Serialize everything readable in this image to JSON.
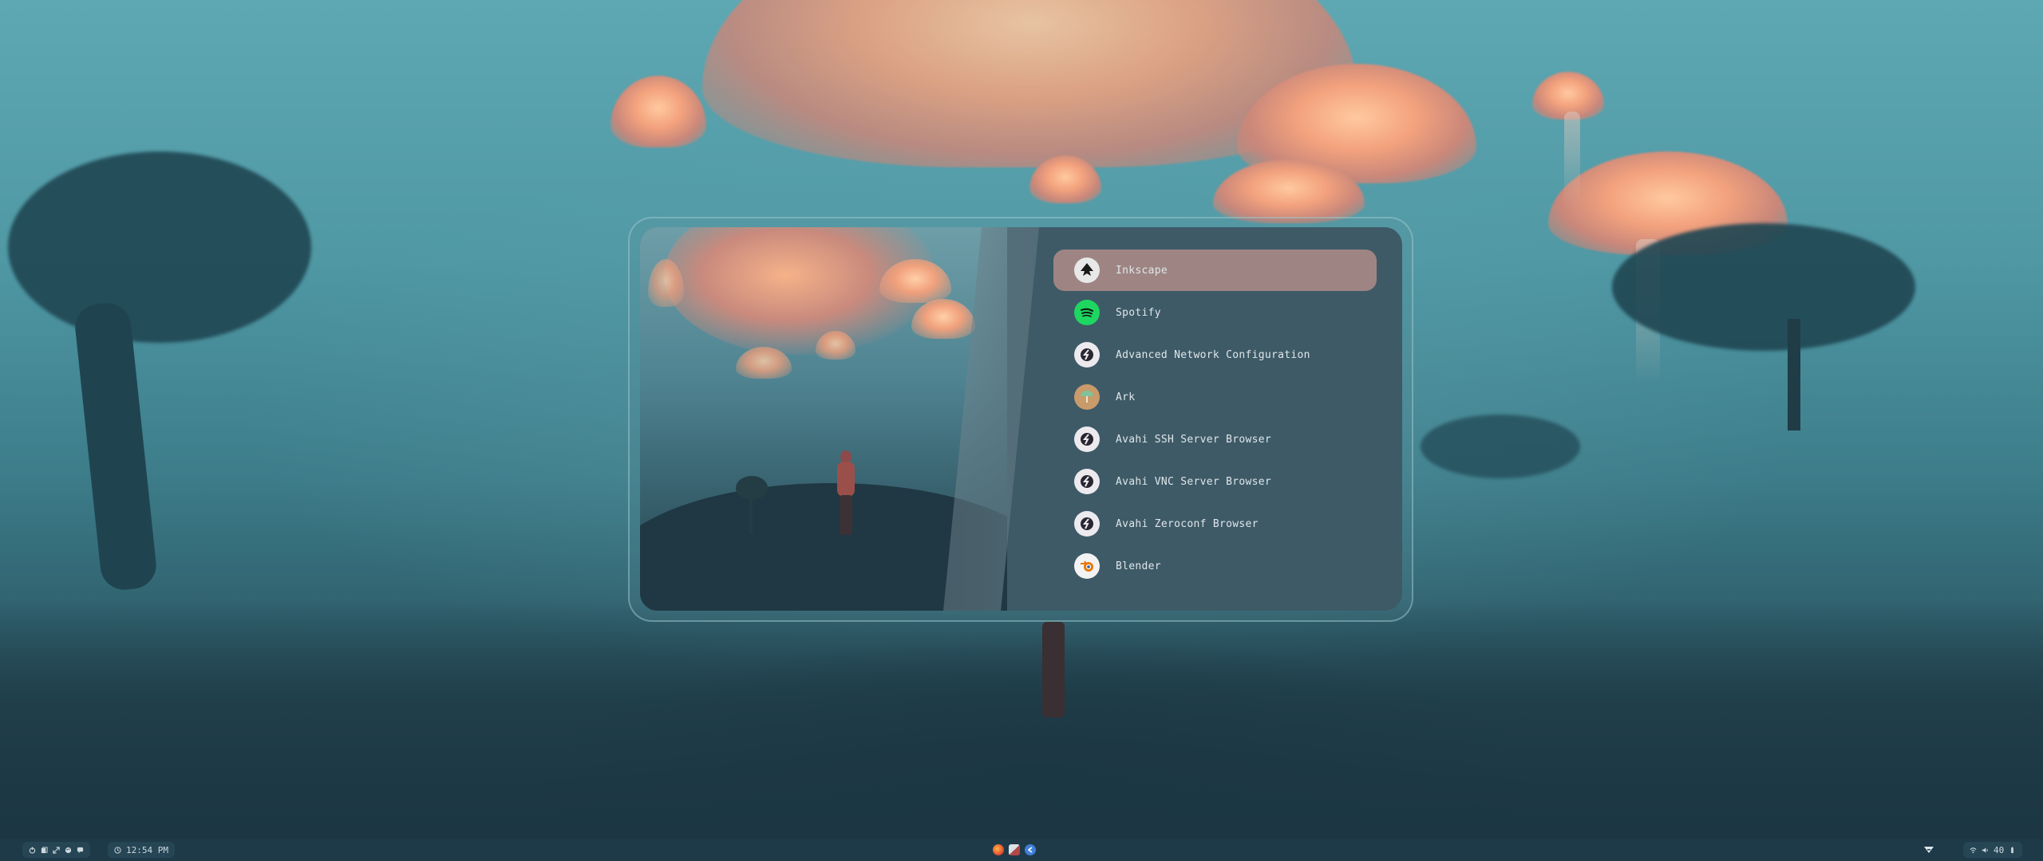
{
  "launcher": {
    "apps": [
      {
        "label": "Inkscape",
        "icon": "inkscape-icon",
        "selected": true
      },
      {
        "label": "Spotify",
        "icon": "spotify-icon",
        "selected": false
      },
      {
        "label": "Advanced Network Configuration",
        "icon": "network-config-icon",
        "selected": false
      },
      {
        "label": "Ark",
        "icon": "ark-icon",
        "selected": false
      },
      {
        "label": "Avahi SSH Server Browser",
        "icon": "avahi-icon",
        "selected": false
      },
      {
        "label": "Avahi VNC Server Browser",
        "icon": "avahi-icon",
        "selected": false
      },
      {
        "label": "Avahi Zeroconf Browser",
        "icon": "avahi-icon",
        "selected": false
      },
      {
        "label": "Blender",
        "icon": "blender-icon",
        "selected": false
      }
    ]
  },
  "taskbar": {
    "clock": "12:54 PM",
    "volume": "40",
    "left_icons": [
      "power-icon",
      "files-icon",
      "expand-icon",
      "palette-icon",
      "chat-icon"
    ],
    "center_apps": [
      "firefox-icon",
      "terminal-icon",
      "app-icon"
    ],
    "right_icons": [
      "wifi-icon",
      "volume-icon",
      "battery-icon"
    ]
  },
  "colors": {
    "selected_bg": "#9e8583",
    "launcher_bg": "#3e5a67",
    "taskbar_bg": "#1e3a48",
    "spotify_green": "#1ed760",
    "blender_orange": "#ea7600"
  }
}
